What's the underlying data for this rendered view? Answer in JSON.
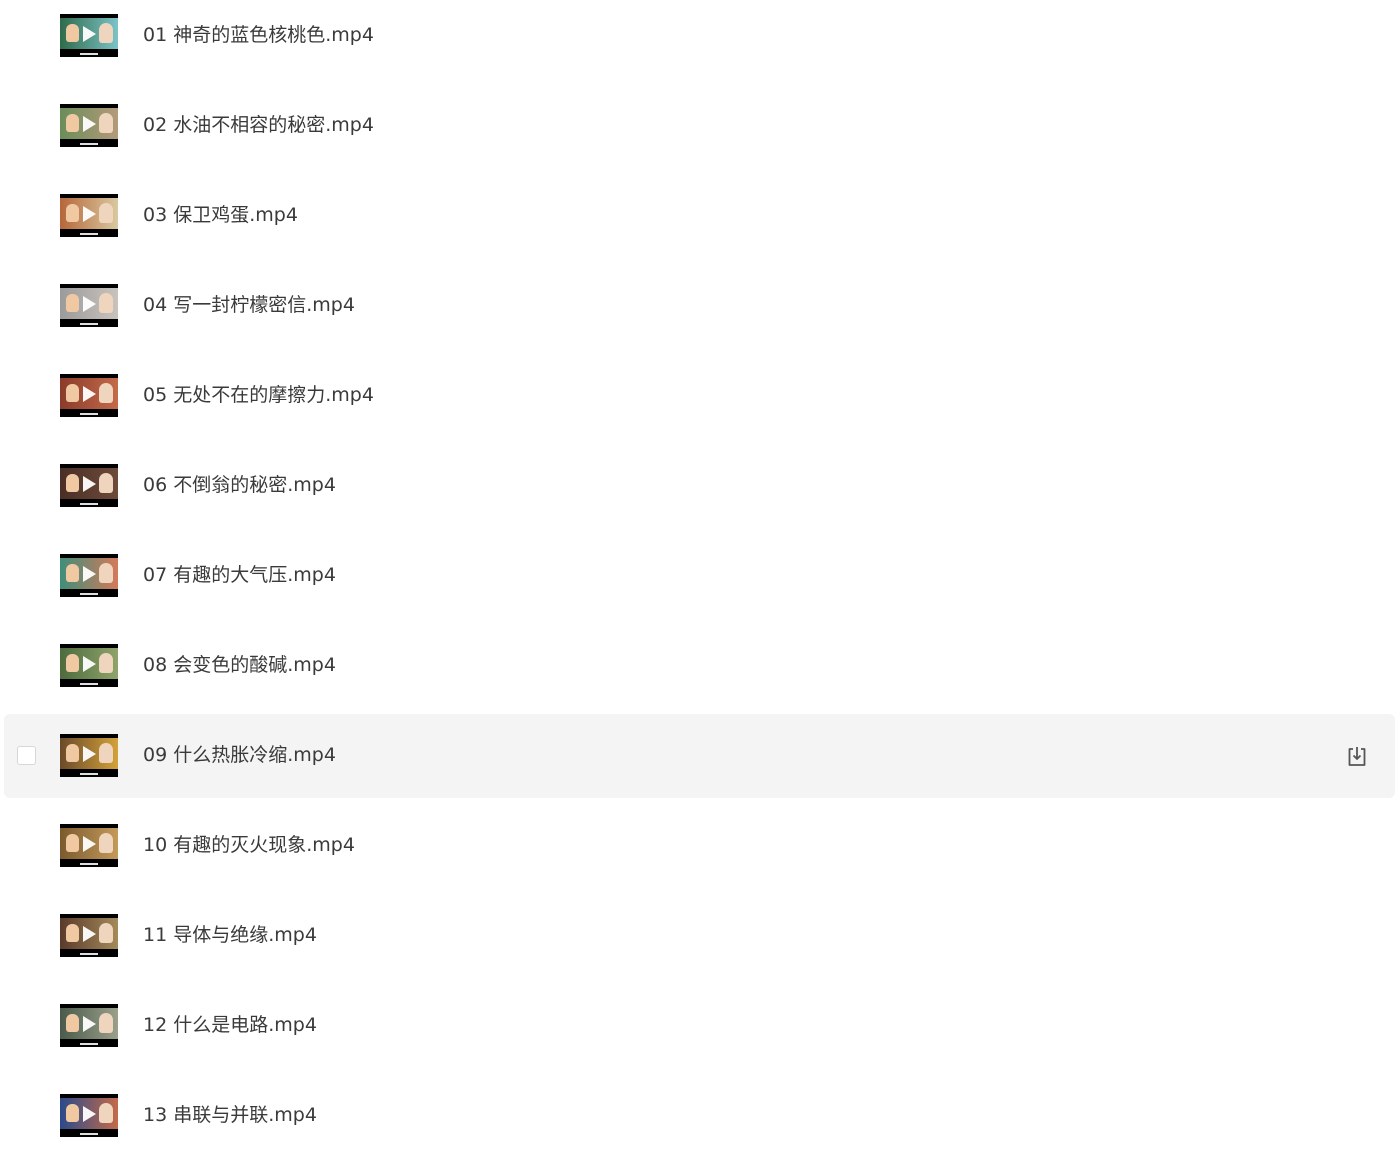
{
  "files": [
    {
      "name": "01 神奇的蓝色核桃色.mp4",
      "thumb_colors": [
        "#2f6b4a",
        "#7cc3c8"
      ]
    },
    {
      "name": "02 水油不相容的秘密.mp4",
      "thumb_colors": [
        "#6a8d5a",
        "#b49a7a"
      ]
    },
    {
      "name": "03 保卫鸡蛋.mp4",
      "thumb_colors": [
        "#b6663a",
        "#d9c9a0"
      ]
    },
    {
      "name": "04 写一封柠檬密信.mp4",
      "thumb_colors": [
        "#9b9b9b",
        "#c9c3bd"
      ]
    },
    {
      "name": "05 无处不在的摩擦力.mp4",
      "thumb_colors": [
        "#8a3b2b",
        "#c46a4a"
      ]
    },
    {
      "name": "06 不倒翁的秘密.mp4",
      "thumb_colors": [
        "#4a2e25",
        "#6d4b3a"
      ]
    },
    {
      "name": "07 有趣的大气压.mp4",
      "thumb_colors": [
        "#3f8e7a",
        "#d47a5a"
      ]
    },
    {
      "name": "08 会变色的酸碱.mp4",
      "thumb_colors": [
        "#4d6b3e",
        "#8fa46a"
      ]
    },
    {
      "name": "09 什么热胀冷缩.mp4",
      "thumb_colors": [
        "#6a4a2a",
        "#d4a23a"
      ]
    },
    {
      "name": "10 有趣的灭火现象.mp4",
      "thumb_colors": [
        "#7a5a2e",
        "#c49a5a"
      ]
    },
    {
      "name": "11 导体与绝缘.mp4",
      "thumb_colors": [
        "#5a3a2a",
        "#a48a5a"
      ]
    },
    {
      "name": "12 什么是电路.mp4",
      "thumb_colors": [
        "#4a5a4a",
        "#9aa08a"
      ]
    },
    {
      "name": "13 串联与并联.mp4",
      "thumb_colors": [
        "#2a4a8a",
        "#c46a4a"
      ]
    }
  ],
  "hovered_row": 8,
  "icons": {
    "checkbox": "checkbox-icon",
    "play": "play-icon",
    "download": "download-icon"
  },
  "colors": {
    "hover_background": "#f4f4f4",
    "text": "#3a3a3a",
    "icon": "#555555"
  }
}
